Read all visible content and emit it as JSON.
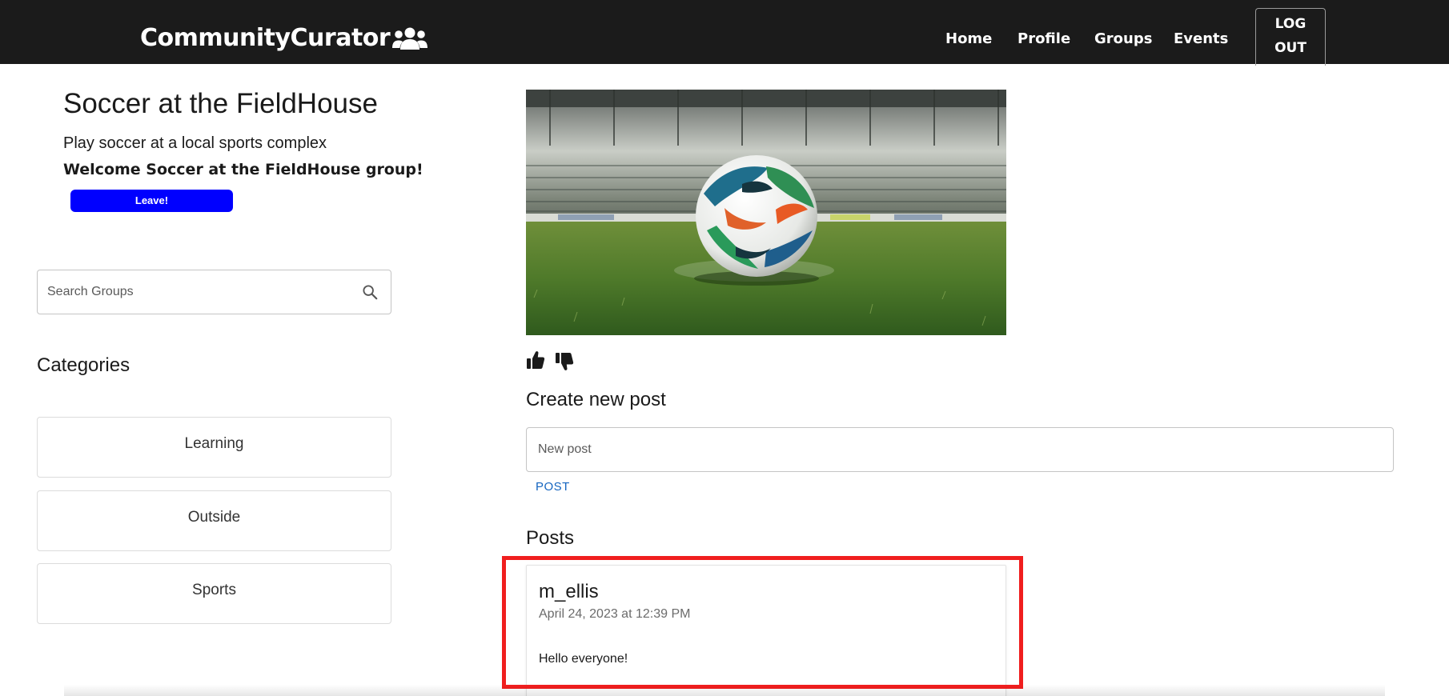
{
  "navbar": {
    "brand": "CommunityCurator",
    "brand_icon": "users-icon",
    "links": [
      "Home",
      "Profile",
      "Groups",
      "Events"
    ],
    "logout_line1": "LOG",
    "logout_line2": "OUT"
  },
  "group": {
    "title": "Soccer at the FieldHouse",
    "description": "Play soccer at a local sports complex",
    "welcome": "Welcome Soccer at the FieldHouse group!",
    "leave_label": "Leave!"
  },
  "search": {
    "placeholder": "Search Groups",
    "icon": "search-icon"
  },
  "categories": {
    "title": "Categories",
    "items": [
      "Learning",
      "Outside",
      "Sports"
    ]
  },
  "reactions": {
    "like_icon": "thumbs-up-icon",
    "dislike_icon": "thumbs-down-icon"
  },
  "create_post": {
    "title": "Create new post",
    "placeholder": "New post",
    "submit_label": "POST"
  },
  "posts": {
    "title": "Posts",
    "items": [
      {
        "author": "m_ellis",
        "date": "April 24, 2023 at 12:39 PM",
        "body": "Hello everyone!"
      }
    ]
  },
  "colors": {
    "navbar_bg": "#1b1b1b",
    "leave_button": "#0000ff",
    "post_link": "#1565c0",
    "highlight": "#f01e1e"
  }
}
